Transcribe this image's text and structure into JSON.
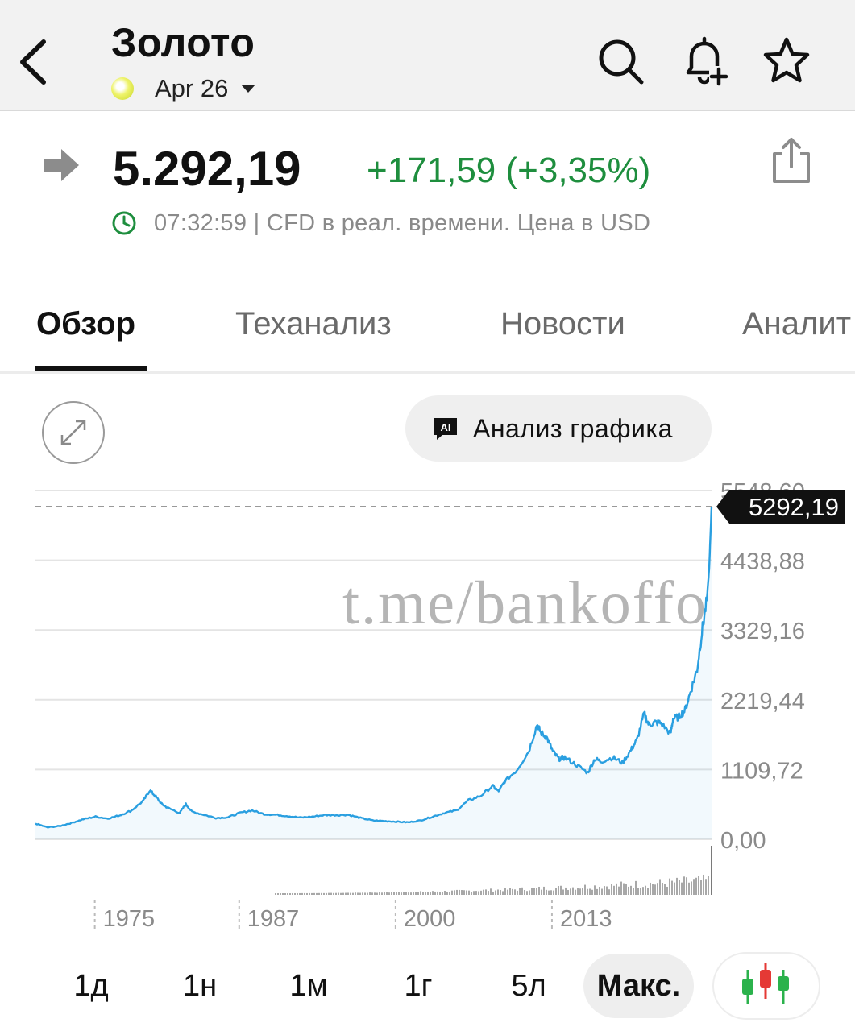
{
  "header": {
    "title": "Золото",
    "contract": "Apr 26"
  },
  "quote": {
    "price": "5.292,19",
    "change": "+171,59 (+3,35%)",
    "meta": "07:32:59 | CFD в реал. времени. Цена в USD"
  },
  "tabs": [
    "Обзор",
    "Теханализ",
    "Новости",
    "Аналит"
  ],
  "tools": {
    "ai_label": "Анализ графика"
  },
  "watermark": "t.me/bankoffo",
  "colors": {
    "positive": "#1e8e3e",
    "line": "#2a9fe0",
    "price_tag": "#111111"
  },
  "chart_data": {
    "type": "line",
    "y_ticks": [
      "5548,60",
      "4438,88",
      "3329,16",
      "2219,44",
      "1109,72",
      "0,00"
    ],
    "x_ticks": [
      "1975",
      "1987",
      "2000",
      "2013"
    ],
    "current_label": "5292,19",
    "ylim": [
      0,
      5548.6
    ],
    "xlim": [
      1970.0,
      2026.2
    ],
    "grid": true,
    "series": [
      {
        "x": [
          1970.0,
          1971.0,
          1972.0,
          1973.0,
          1974.0,
          1975.0,
          1976.0,
          1977.0,
          1978.0,
          1979.0,
          1979.5,
          1980.0,
          1980.5,
          1981.0,
          1982.0,
          1982.5,
          1983.0,
          1984.0,
          1985.0,
          1986.0,
          1987.0,
          1988.0,
          1989.0,
          1990.0,
          1991.0,
          1992.0,
          1993.0,
          1994.0,
          1995.0,
          1996.0,
          1997.0,
          1998.0,
          1999.0,
          2000.0,
          2001.0,
          2002.0,
          2003.0,
          2004.0,
          2005.0,
          2006.0,
          2007.0,
          2008.0,
          2008.5,
          2009.0,
          2010.0,
          2011.0,
          2011.7,
          2012.0,
          2012.5,
          2013.0,
          2013.5,
          2014.0,
          2015.0,
          2015.9,
          2016.5,
          2017.0,
          2018.0,
          2018.8,
          2019.5,
          2020.0,
          2020.6,
          2021.0,
          2021.5,
          2022.0,
          2022.8,
          2023.0,
          2023.5,
          2024.0,
          2024.5,
          2025.0,
          2025.4,
          2025.8,
          2026.0,
          2026.2
        ],
        "y": [
          250,
          190,
          210,
          260,
          320,
          360,
          330,
          380,
          460,
          620,
          780,
          680,
          560,
          500,
          420,
          560,
          440,
          390,
          340,
          350,
          420,
          460,
          400,
          390,
          370,
          345,
          360,
          385,
          385,
          390,
          340,
          300,
          290,
          280,
          270,
          300,
          360,
          420,
          460,
          620,
          690,
          850,
          760,
          920,
          1100,
          1400,
          1830,
          1700,
          1620,
          1400,
          1280,
          1300,
          1180,
          1060,
          1280,
          1240,
          1300,
          1220,
          1420,
          1580,
          2000,
          1820,
          1860,
          1850,
          1680,
          1920,
          1950,
          2060,
          2380,
          2700,
          3300,
          3800,
          4300,
          5292.19
        ]
      }
    ]
  }
}
